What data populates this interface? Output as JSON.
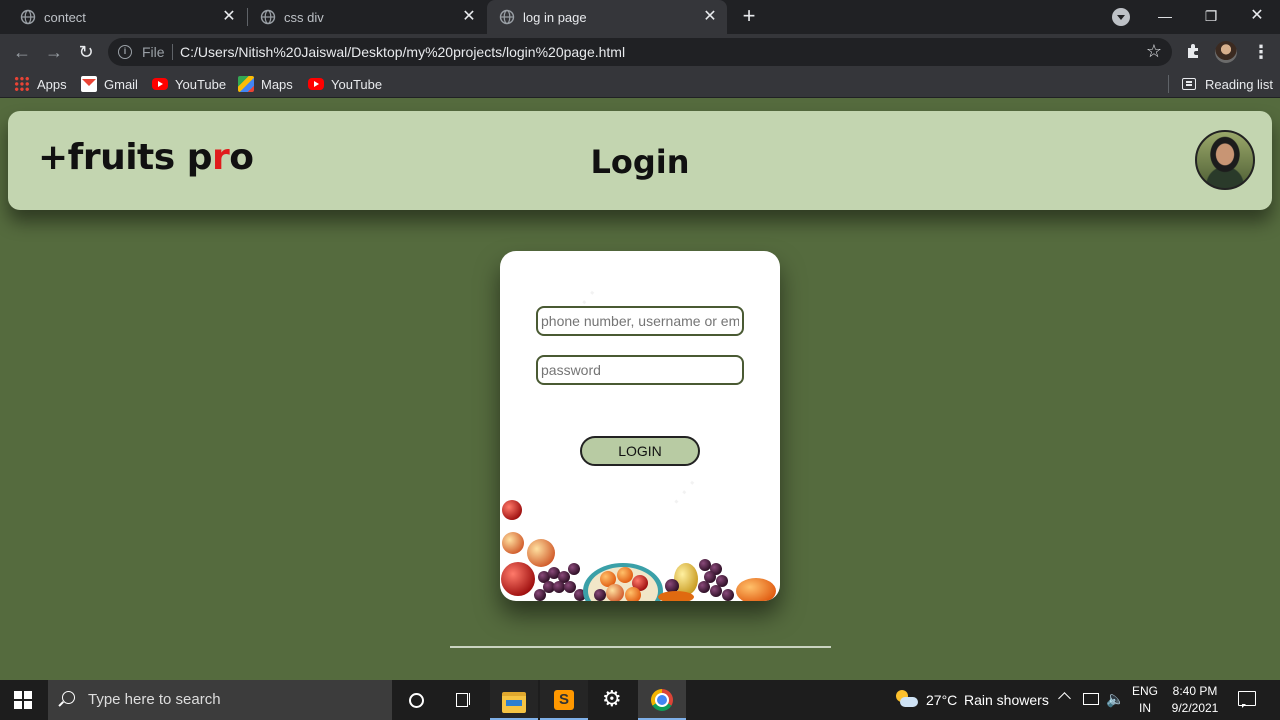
{
  "browser": {
    "tabs": [
      {
        "title": "contect"
      },
      {
        "title": "css div"
      },
      {
        "title": "log in page"
      }
    ],
    "address": {
      "scheme_label": "File",
      "url": "C:/Users/Nitish%20Jaiswal/Desktop/my%20projects/login%20page.html"
    },
    "bookmarks": [
      {
        "label": "Apps",
        "icon": "apps-grid-icon"
      },
      {
        "label": "Gmail",
        "icon": "gmail-icon"
      },
      {
        "label": "YouTube",
        "icon": "youtube-icon"
      },
      {
        "label": "Maps",
        "icon": "maps-icon"
      },
      {
        "label": "YouTube",
        "icon": "youtube-icon"
      }
    ],
    "reading_list": "Reading list"
  },
  "page": {
    "brand": {
      "prefix": "+fruits p",
      "accent": "r",
      "suffix": "o"
    },
    "title": "Login",
    "form": {
      "username_placeholder": "phone number, username or email",
      "password_placeholder": "password",
      "login_label": "LOGIN"
    },
    "colors": {
      "background": "#556b3e",
      "header": "#c3d5b0",
      "button": "#b8cba3",
      "brand_accent": "#e01b1b"
    }
  },
  "taskbar": {
    "search_placeholder": "Type here to search",
    "weather": {
      "temp": "27°C",
      "condition": "Rain showers"
    },
    "language": {
      "lang": "ENG",
      "region": "IN"
    },
    "clock": {
      "time": "8:40 PM",
      "date": "9/2/2021"
    }
  }
}
